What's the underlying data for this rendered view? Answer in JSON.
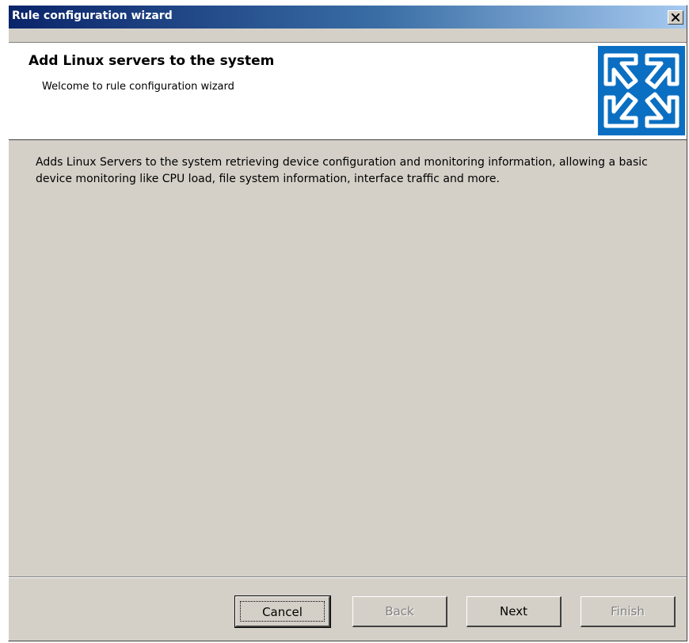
{
  "window": {
    "title": "Rule configuration wizard"
  },
  "header": {
    "heading": "Add Linux servers to the system",
    "subheading": "Welcome to rule configuration wizard",
    "logo_icon": "wizard-logo-icon",
    "logo_color": "#0a6fc2"
  },
  "main": {
    "description": "Adds Linux Servers to the system retrieving device configuration and monitoring information, allowing a basic device monitoring like CPU load, file system information, interface traffic and more."
  },
  "buttons": {
    "cancel": "Cancel",
    "back": "Back",
    "next": "Next",
    "finish": "Finish"
  }
}
